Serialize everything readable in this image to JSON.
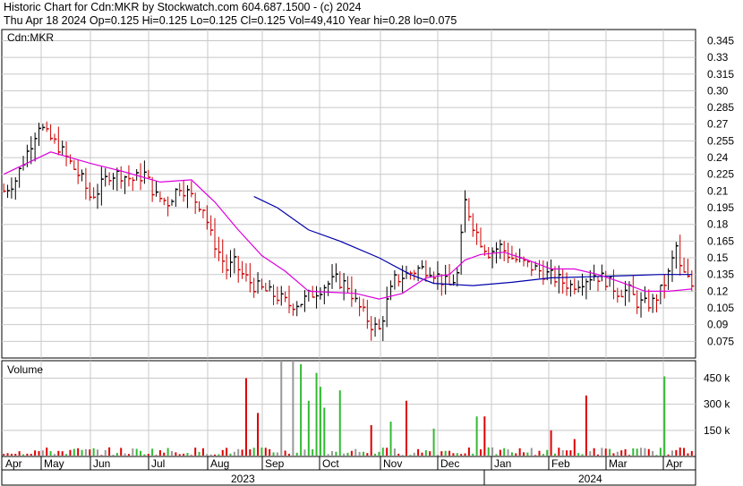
{
  "header": {
    "line1": "Historic Chart for Cdn:MKR by Stockwatch.com 604.687.1500 - (c) 2024",
    "line2": "Thu Apr 18 2024   Op=0.125   Hi=0.125   Lo=0.125   Cl=0.125   Vol=49,410   Year hi=0.28   lo=0.075"
  },
  "colors": {
    "up": "#000000",
    "down": "#cc0000",
    "ma_short": "#dd00dd",
    "ma_long": "#0000aa",
    "vol_red": "#dd0000",
    "vol_green": "#33bb33",
    "vol_gray": "#999999",
    "grid": "#c8c8c8"
  },
  "chart_data": [
    {
      "type": "ohlc",
      "label": "Cdn:MKR",
      "ylim": [
        0.06,
        0.355
      ],
      "y_ticks": [
        "0.345",
        "0.33",
        "0.315",
        "0.30",
        "0.285",
        "0.27",
        "0.255",
        "0.24",
        "0.225",
        "0.21",
        "0.195",
        "0.18",
        "0.165",
        "0.15",
        "0.135",
        "0.12",
        "0.105",
        "0.09",
        "0.075"
      ],
      "x_months": [
        "Apr",
        "May",
        "Jun",
        "Jul",
        "Aug",
        "Sep",
        "Oct",
        "Nov",
        "Dec",
        "Jan",
        "Feb",
        "Mar",
        "Apr"
      ],
      "x_years": [
        "2023",
        "2024"
      ],
      "price_path": [
        [
          0,
          0.21
        ],
        [
          3,
          0.22
        ],
        [
          6,
          0.245
        ],
        [
          9,
          0.27
        ],
        [
          11,
          0.26
        ],
        [
          14,
          0.25
        ],
        [
          17,
          0.235
        ],
        [
          20,
          0.22
        ],
        [
          22,
          0.205
        ],
        [
          24,
          0.21
        ],
        [
          27,
          0.225
        ],
        [
          30,
          0.225
        ],
        [
          33,
          0.22
        ],
        [
          36,
          0.225
        ],
        [
          39,
          0.205
        ],
        [
          42,
          0.2
        ],
        [
          45,
          0.215
        ],
        [
          48,
          0.205
        ],
        [
          51,
          0.195
        ],
        [
          53,
          0.17
        ],
        [
          55,
          0.155
        ],
        [
          57,
          0.14
        ],
        [
          59,
          0.145
        ],
        [
          61,
          0.135
        ],
        [
          64,
          0.125
        ],
        [
          67,
          0.12
        ],
        [
          70,
          0.115
        ],
        [
          73,
          0.108
        ],
        [
          76,
          0.11
        ],
        [
          79,
          0.118
        ],
        [
          82,
          0.125
        ],
        [
          85,
          0.13
        ],
        [
          88,
          0.125
        ],
        [
          90,
          0.11
        ],
        [
          92,
          0.1
        ],
        [
          94,
          0.09
        ],
        [
          96,
          0.085
        ],
        [
          98,
          0.11
        ],
        [
          100,
          0.13
        ],
        [
          103,
          0.135
        ],
        [
          106,
          0.14
        ],
        [
          109,
          0.14
        ],
        [
          112,
          0.13
        ],
        [
          114,
          0.125
        ],
        [
          116,
          0.135
        ],
        [
          118,
          0.2
        ],
        [
          120,
          0.18
        ],
        [
          122,
          0.165
        ],
        [
          124,
          0.155
        ],
        [
          127,
          0.16
        ],
        [
          130,
          0.15
        ],
        [
          133,
          0.145
        ],
        [
          136,
          0.14
        ],
        [
          139,
          0.135
        ],
        [
          142,
          0.13
        ],
        [
          145,
          0.125
        ],
        [
          148,
          0.13
        ],
        [
          151,
          0.135
        ],
        [
          154,
          0.13
        ],
        [
          157,
          0.12
        ],
        [
          160,
          0.12
        ],
        [
          162,
          0.11
        ],
        [
          164,
          0.108
        ],
        [
          166,
          0.11
        ],
        [
          168,
          0.12
        ],
        [
          170,
          0.135
        ],
        [
          172,
          0.16
        ],
        [
          173,
          0.14
        ],
        [
          175,
          0.13
        ],
        [
          176,
          0.125
        ]
      ],
      "ma_short": [
        [
          0,
          0.225
        ],
        [
          12,
          0.245
        ],
        [
          22,
          0.235
        ],
        [
          30,
          0.228
        ],
        [
          40,
          0.218
        ],
        [
          48,
          0.22
        ],
        [
          54,
          0.2
        ],
        [
          60,
          0.175
        ],
        [
          66,
          0.152
        ],
        [
          72,
          0.138
        ],
        [
          78,
          0.12
        ],
        [
          84,
          0.119
        ],
        [
          90,
          0.118
        ],
        [
          96,
          0.113
        ],
        [
          102,
          0.118
        ],
        [
          108,
          0.132
        ],
        [
          114,
          0.135
        ],
        [
          118,
          0.148
        ],
        [
          122,
          0.153
        ],
        [
          128,
          0.155
        ],
        [
          134,
          0.148
        ],
        [
          140,
          0.14
        ],
        [
          146,
          0.14
        ],
        [
          152,
          0.135
        ],
        [
          158,
          0.128
        ],
        [
          164,
          0.12
        ],
        [
          170,
          0.12
        ],
        [
          176,
          0.122
        ]
      ],
      "ma_long": [
        [
          64,
          0.205
        ],
        [
          70,
          0.195
        ],
        [
          78,
          0.175
        ],
        [
          86,
          0.165
        ],
        [
          96,
          0.15
        ],
        [
          104,
          0.135
        ],
        [
          110,
          0.127
        ],
        [
          120,
          0.125
        ],
        [
          130,
          0.128
        ],
        [
          140,
          0.132
        ],
        [
          150,
          0.133
        ],
        [
          160,
          0.134
        ],
        [
          168,
          0.135
        ],
        [
          176,
          0.135
        ]
      ]
    },
    {
      "type": "bar",
      "label": "Volume",
      "ylim": [
        0,
        550000
      ],
      "y_ticks": [
        "450 k",
        "300 k",
        "150 k"
      ],
      "spikes": [
        [
          62,
          450000,
          "red"
        ],
        [
          71,
          550000,
          "gray"
        ],
        [
          74,
          550000,
          "gray"
        ],
        [
          76,
          530000,
          "green"
        ],
        [
          80,
          480000,
          "green"
        ],
        [
          81,
          400000,
          "green"
        ],
        [
          78,
          320000,
          "green"
        ],
        [
          82,
          280000,
          "green"
        ],
        [
          86,
          380000,
          "green"
        ],
        [
          103,
          320000,
          "red"
        ],
        [
          121,
          230000,
          "green"
        ],
        [
          123,
          230000,
          "red"
        ],
        [
          149,
          350000,
          "red"
        ],
        [
          169,
          460000,
          "green"
        ],
        [
          65,
          250000,
          "red"
        ],
        [
          99,
          200000,
          "green"
        ],
        [
          94,
          180000,
          "red"
        ],
        [
          110,
          160000,
          "green"
        ],
        [
          140,
          150000,
          "red"
        ],
        [
          146,
          100000,
          "red"
        ]
      ]
    }
  ]
}
